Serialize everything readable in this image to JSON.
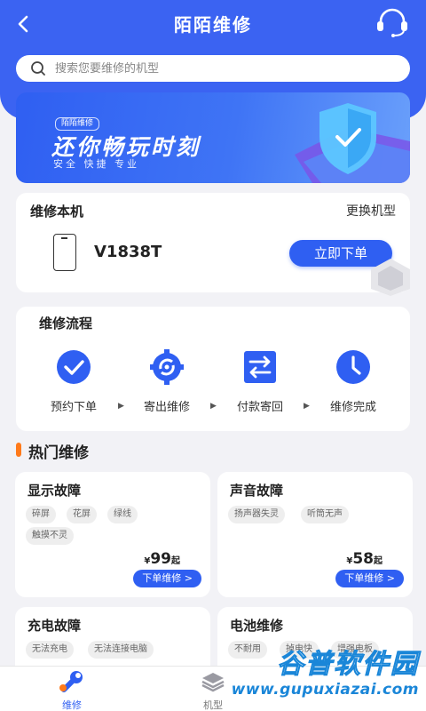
{
  "header": {
    "title": "陌陌维修",
    "search_placeholder": "搜索您要维修的机型"
  },
  "banner": {
    "tag": "陌陌维修",
    "title": "还你畅玩时刻",
    "subtitle": "安全 快捷 专业"
  },
  "device": {
    "section_title": "维修本机",
    "change_label": "更换机型",
    "model": "V1838T",
    "order_label": "立即下单"
  },
  "flow": {
    "title": "维修流程",
    "steps": [
      {
        "label": "预约下单",
        "icon": "check-icon"
      },
      {
        "label": "寄出维修",
        "icon": "gear-refresh-icon"
      },
      {
        "label": "付款寄回",
        "icon": "exchange-icon"
      },
      {
        "label": "维修完成",
        "icon": "clock-icon"
      }
    ],
    "arrow": "▶"
  },
  "hot": {
    "title": "热门维修",
    "services": [
      {
        "title": "显示故障",
        "chips": [
          "碎屏",
          "花屏",
          "绿线",
          "触摸不灵"
        ],
        "price_symbol": "¥",
        "price": "99",
        "price_suffix": "起",
        "button": "下单维修 >"
      },
      {
        "title": "声音故障",
        "chips": [
          "扬声器失灵",
          "听筒无声"
        ],
        "price_symbol": "¥",
        "price": "58",
        "price_suffix": "起",
        "button": "下单维修 >"
      },
      {
        "title": "充电故障",
        "chips": [
          "无法充电",
          "无法连接电脑"
        ]
      },
      {
        "title": "电池维修",
        "chips": [
          "不耐用",
          "掉电快",
          "增强电板"
        ]
      }
    ]
  },
  "tabs": [
    {
      "label": "维修",
      "icon": "wrench-icon",
      "active": true
    },
    {
      "label": "机型",
      "icon": "layers-icon",
      "active": false
    }
  ],
  "watermark": {
    "name": "谷普软件园",
    "url": "www.gupuxiazai.com"
  },
  "colors": {
    "primary": "#3b63f2",
    "accent": "#ff7a1a",
    "tab_active": "#2f5ff2"
  }
}
